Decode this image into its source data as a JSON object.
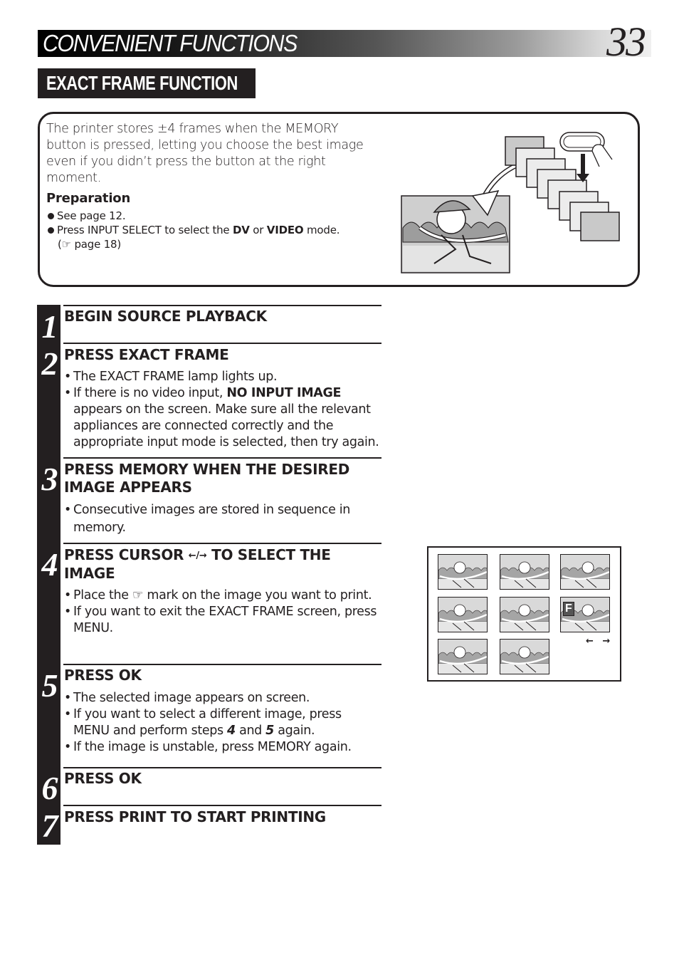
{
  "header": {
    "section_title": "CONVENIENT FUNCTIONS",
    "page_number": "33"
  },
  "section_tag": "EXACT FRAME FUNCTION",
  "intro": {
    "text": "The printer stores ±4 frames when the MEMORY button is pressed, letting you choose the best image even if you didn’t press the button at the right moment.",
    "preparation_heading": "Preparation",
    "preparation_items": [
      {
        "text": "See page 12."
      },
      {
        "pre": "Press INPUT SELECT to select the ",
        "bold1": "DV",
        "mid": " or ",
        "bold2": "VIDEO",
        "post": " mode.",
        "ref_icon": "☞",
        "ref": " page 18)"
      }
    ]
  },
  "steps": [
    {
      "number": "1",
      "title": "BEGIN SOURCE PLAYBACK",
      "bullets": []
    },
    {
      "number": "2",
      "title": "PRESS EXACT FRAME",
      "bullets": [
        {
          "text": "The EXACT FRAME lamp lights up."
        },
        {
          "pre": "If there is no video input, ",
          "bold": "NO INPUT IMAGE",
          "post": " appears on the screen. Make sure all the relevant appliances are connected correctly and the appropriate input mode is selected, then try again."
        }
      ]
    },
    {
      "number": "3",
      "title": "PRESS MEMORY WHEN THE DESIRED IMAGE APPEARS",
      "bullets": [
        {
          "text": "Consecutive images are stored in sequence in memory."
        }
      ]
    },
    {
      "number": "4",
      "title_pre": "PRESS CURSOR ",
      "title_arrows": "←/→",
      "title_post": " TO SELECT THE IMAGE",
      "bullets": [
        {
          "pre": "Place the ",
          "icon": "☞",
          "post": " mark on the image you want to print."
        },
        {
          "text": "If you want to exit the EXACT FRAME screen, press MENU."
        }
      ]
    },
    {
      "number": "5",
      "title": "PRESS OK",
      "bullets": [
        {
          "text": "The selected image appears on screen."
        },
        {
          "pre": "If you want to select a different image, press MENU and perform steps ",
          "b1": "4",
          "mid": " and ",
          "b2": "5",
          "post": " again."
        },
        {
          "text": "If the image is unstable, press MEMORY again."
        }
      ]
    },
    {
      "number": "6",
      "title": "PRESS OK",
      "bullets": []
    },
    {
      "number": "7",
      "title": "PRESS PRINT TO START PRINTING",
      "bullets": []
    }
  ],
  "screen": {
    "thumbnail_count": 8,
    "selected_marker": "F",
    "nav_arrows": "← →"
  }
}
